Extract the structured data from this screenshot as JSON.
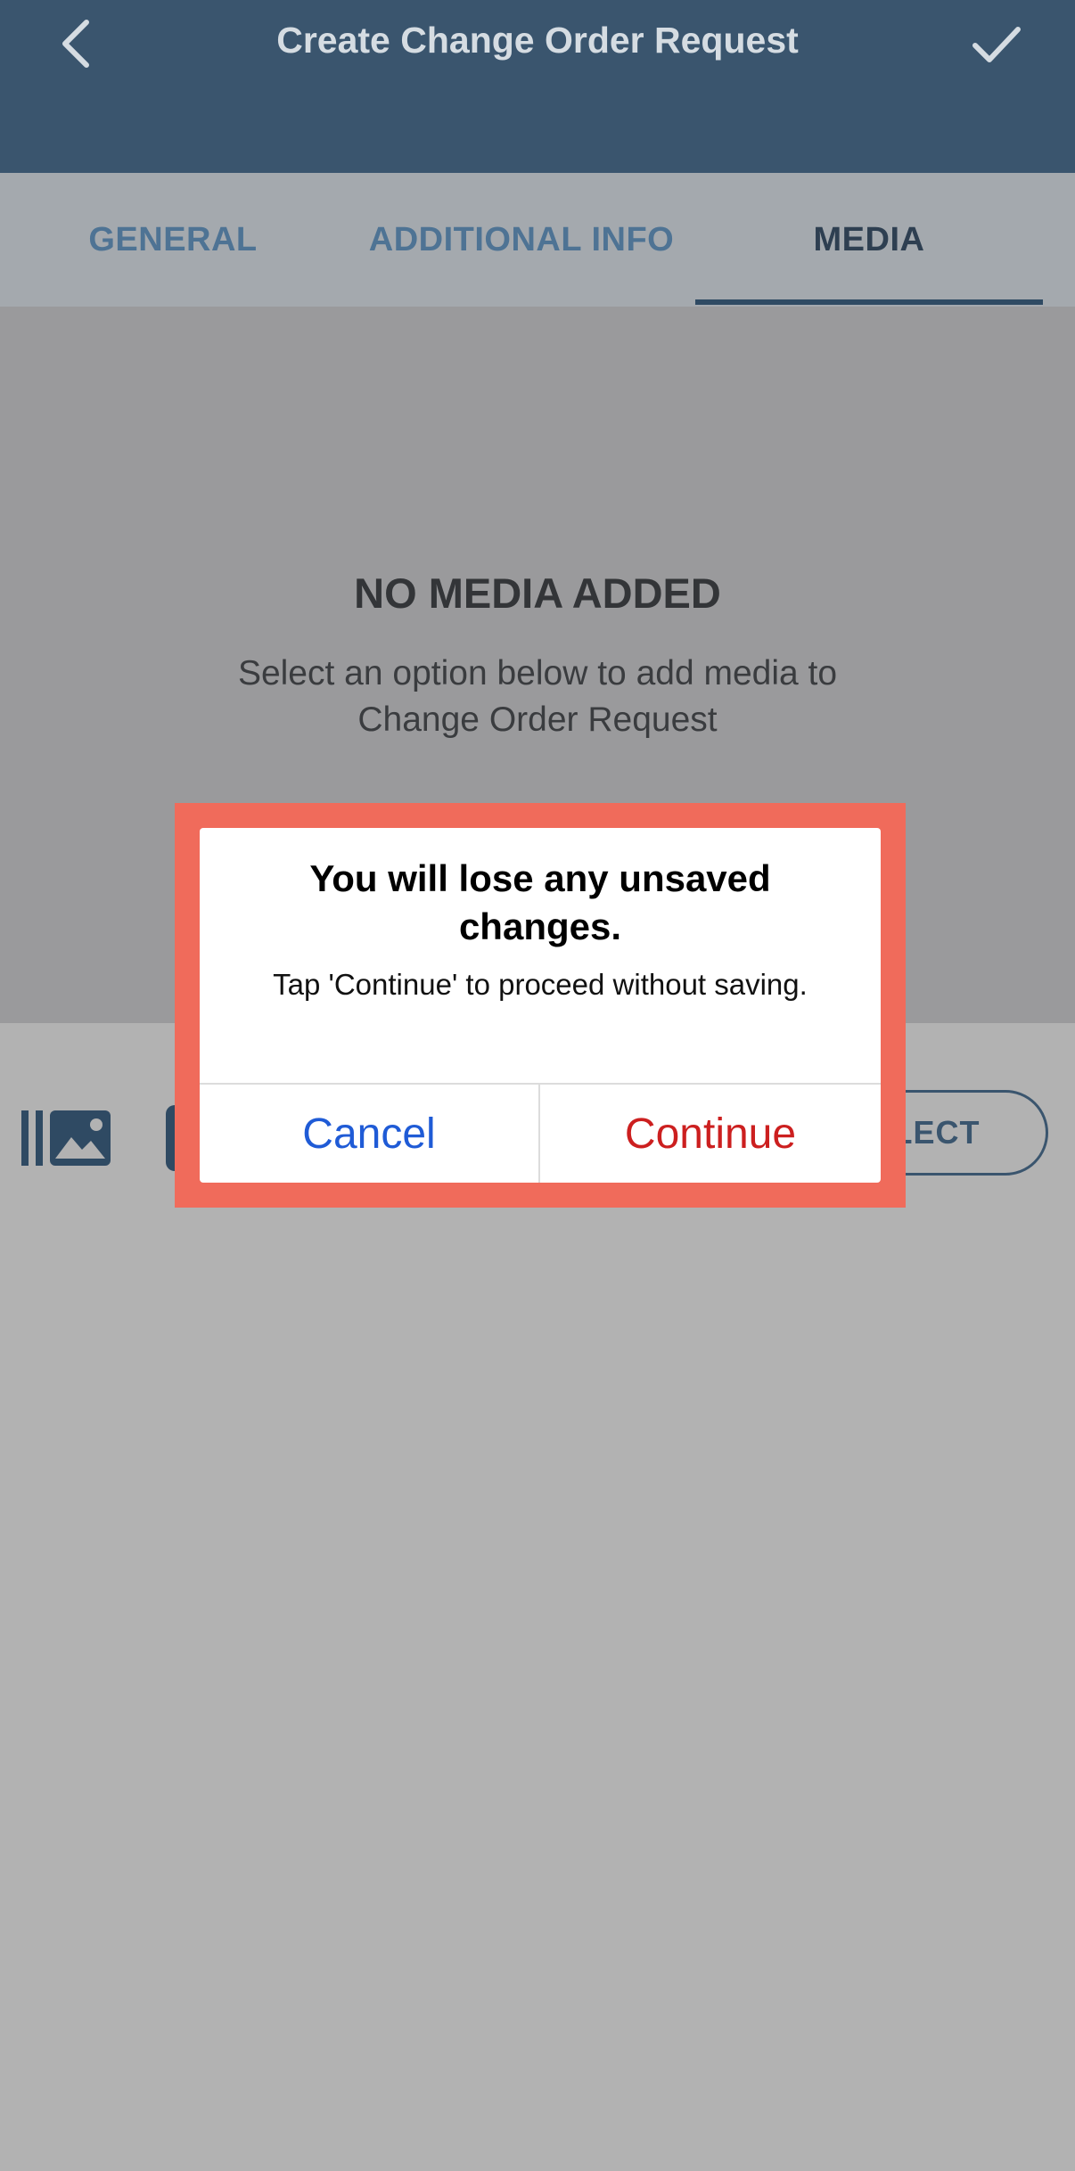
{
  "header": {
    "title": "Create Change Order Request",
    "back_icon": "chevron-left-icon",
    "confirm_icon": "checkmark-icon",
    "background": "#3a556e"
  },
  "tabs": [
    {
      "label": "GENERAL",
      "active": false
    },
    {
      "label": "ADDITIONAL INFO",
      "active": false
    },
    {
      "label": "MEDIA",
      "active": true
    }
  ],
  "media": {
    "empty_title": "NO MEDIA ADDED",
    "empty_description": "Select an option below to add media to Change Order Request"
  },
  "toolbar": {
    "gallery_icon": "photo-library-icon",
    "camera_icon": "camera-icon",
    "select_label": "ELECT"
  },
  "dialog": {
    "title": "You will lose any unsaved changes.",
    "message": "Tap 'Continue' to proceed without saving.",
    "cancel_label": "Cancel",
    "continue_label": "Continue",
    "highlight_color": "#f06b5b",
    "cancel_color": "#1f5bd6",
    "continue_color": "#cc1f1f"
  }
}
